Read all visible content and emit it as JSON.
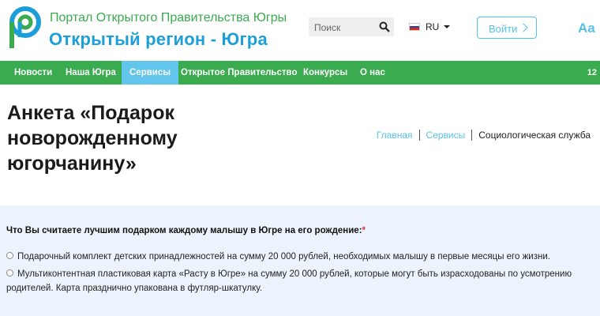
{
  "header": {
    "portal_title": "Портал Открытого Правительства Югры",
    "site_name": "Открытый регион - Югра",
    "search_placeholder": "Поиск",
    "language": "RU",
    "login_label": "Войти",
    "font_size_toggle": "Aa",
    "colors": {
      "green": "#3aab4f",
      "blue": "#1c9fd8",
      "light_blue": "#56c2e6"
    }
  },
  "nav": {
    "items": [
      {
        "label": "Новости"
      },
      {
        "label": "Наша Югра"
      },
      {
        "label": "Сервисы",
        "active": true
      },
      {
        "label": "Открытое Правительство"
      },
      {
        "label": "Конкурсы"
      },
      {
        "label": "О нас"
      }
    ],
    "extra": "12"
  },
  "page": {
    "title": "Анкета «Подарок новорожденному югорчанину»",
    "breadcrumb": [
      "Главная",
      "Сервисы",
      "Социологическая служба"
    ]
  },
  "survey": {
    "question": "Что Вы считаете лучшим подарком каждому малышу в Югре на его рождение:",
    "required_mark": "*",
    "options": [
      "Подарочный комплект детских принадлежностей на сумму 20 000 рублей, необходимых малышу в первые месяцы его жизни.",
      "Мультиконтентная пластиковая карта «Расту в Югре» на сумму 20 000 рублей, которые могут быть израсходованы по усмотрению родителей. Карта празднично упакована в футляр-шкатулку."
    ]
  }
}
